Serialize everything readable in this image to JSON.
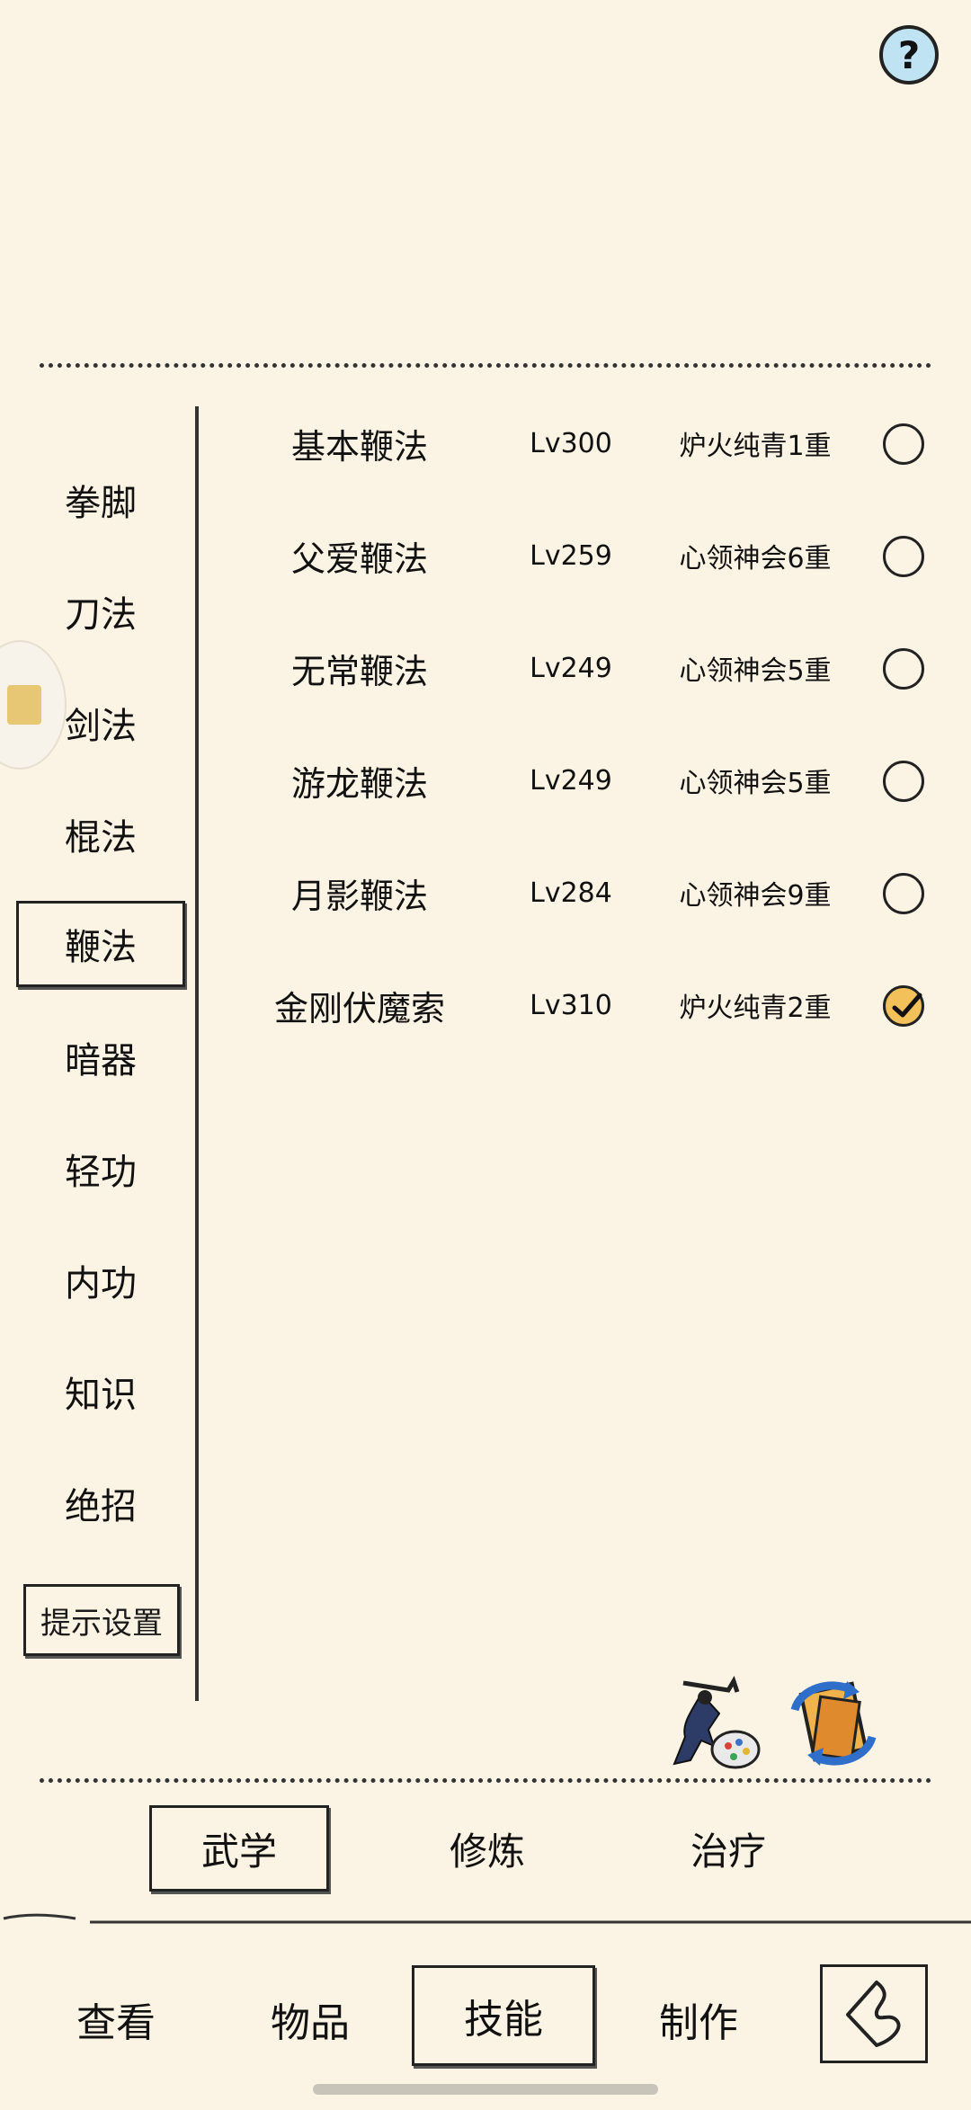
{
  "help": {
    "glyph": "?"
  },
  "categories": [
    {
      "label": "拳脚",
      "active": false
    },
    {
      "label": "刀法",
      "active": false
    },
    {
      "label": "剑法",
      "active": false
    },
    {
      "label": "棍法",
      "active": false
    },
    {
      "label": "鞭法",
      "active": true
    },
    {
      "label": "暗器",
      "active": false
    },
    {
      "label": "轻功",
      "active": false
    },
    {
      "label": "内功",
      "active": false
    },
    {
      "label": "知识",
      "active": false
    },
    {
      "label": "绝招",
      "active": false
    }
  ],
  "hint_settings_label": "提示设置",
  "skills": [
    {
      "name": "基本鞭法",
      "level": "Lv300",
      "rank": "炉火纯青1重",
      "selected": false
    },
    {
      "name": "父爱鞭法",
      "level": "Lv259",
      "rank": "心领神会6重",
      "selected": false
    },
    {
      "name": "无常鞭法",
      "level": "Lv249",
      "rank": "心领神会5重",
      "selected": false
    },
    {
      "name": "游龙鞭法",
      "level": "Lv249",
      "rank": "心领神会5重",
      "selected": false
    },
    {
      "name": "月影鞭法",
      "level": "Lv284",
      "rank": "心领神会9重",
      "selected": false
    },
    {
      "name": "金刚伏魔索",
      "level": "Lv310",
      "rank": "炉火纯青2重",
      "selected": true
    }
  ],
  "tool_icons": [
    "martial-artist-palette-icon",
    "book-swap-icon"
  ],
  "sub_tabs": [
    {
      "label": "武学",
      "active": true
    },
    {
      "label": "修炼",
      "active": false
    },
    {
      "label": "治疗",
      "active": false
    }
  ],
  "bottom_tabs": [
    {
      "label": "查看",
      "active": false
    },
    {
      "label": "物品",
      "active": false
    },
    {
      "label": "技能",
      "active": true
    },
    {
      "label": "制作",
      "active": false
    }
  ],
  "colors": {
    "background": "#fbf4e4",
    "help_bg": "#bfe3f2",
    "check_fill": "#f3c15a"
  }
}
